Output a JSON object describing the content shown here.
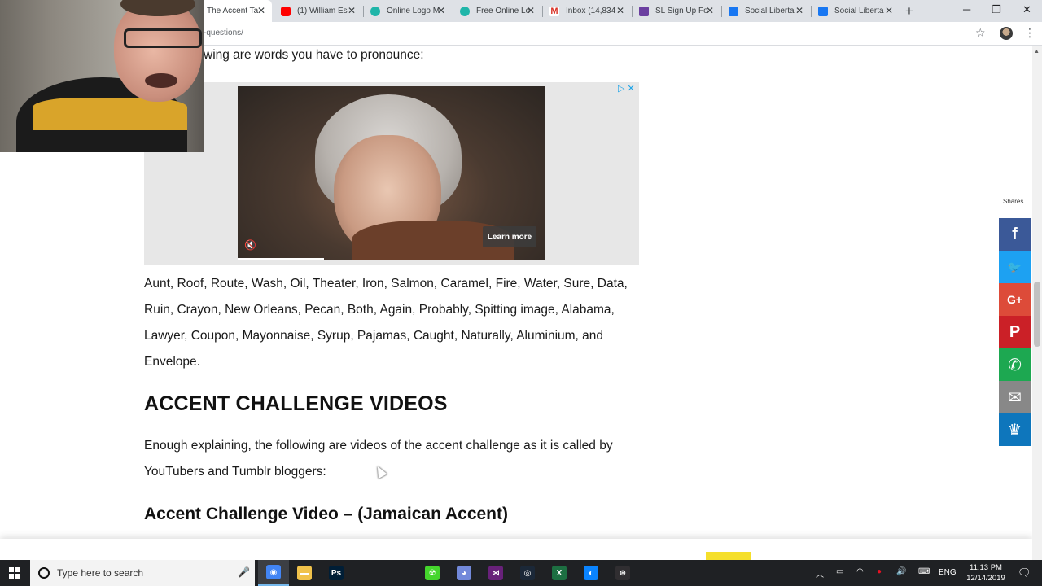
{
  "browser": {
    "tabs": [
      {
        "label": "The Accent Ta",
        "icon": "page-favicon-icon",
        "color": "#e8eaed",
        "active": true
      },
      {
        "label": "(1) William Es",
        "icon": "youtube-icon",
        "color": "#ff0000"
      },
      {
        "label": "Online Logo M",
        "icon": "logo-maker-icon",
        "color": "#1fb5a9"
      },
      {
        "label": "Free Online Lo",
        "icon": "logo-maker-icon",
        "color": "#1fb5a9"
      },
      {
        "label": "Inbox (14,834",
        "icon": "gmail-icon",
        "color": "#d93025"
      },
      {
        "label": "SL Sign Up Fo",
        "icon": "form-icon",
        "color": "#6b3fa0"
      },
      {
        "label": "Social Liberta",
        "icon": "facebook-icon",
        "color": "#1877f2"
      },
      {
        "label": "Social Liberta",
        "icon": "facebook-icon",
        "color": "#1877f2"
      }
    ],
    "new_tab": "+",
    "url": "-questions/",
    "window_controls": {
      "minimize": "─",
      "restore": "❐",
      "close": "✕"
    }
  },
  "article": {
    "intro_partial": "wing are words you have to pronounce:",
    "word_lines": [
      "Aunt, Roof, Route, Wash, Oil, Theater, Iron, Salmon, Caramel, Fire, Water, Sure, Data,",
      "Ruin, Crayon, New Orleans, Pecan, Both, Again, Probably, Spitting image, Alabama,",
      "Lawyer, Coupon, Mayonnaise, Syrup, Pajamas, Caught, Naturally, Aluminium, and",
      "Envelope."
    ],
    "section_heading": "ACCENT CHALLENGE VIDEOS",
    "explain_lines": [
      "Enough explaining, the following are videos of the accent challenge as it is called by",
      "YouTubers and Tumblr bloggers:"
    ],
    "sub_heading": "Accent Challenge Video – (Jamaican Accent)"
  },
  "ad": {
    "learn_more": "Learn more",
    "adchoices": "▷✕",
    "mute_icon": "🔇",
    "progress_fraction": 0.28
  },
  "share": {
    "label": "Shares",
    "buttons": [
      {
        "name": "facebook",
        "glyph": "f",
        "color": "#3b5998"
      },
      {
        "name": "twitter",
        "glyph": "🐦",
        "color": "#1da1f2"
      },
      {
        "name": "google-plus",
        "glyph": "G+",
        "color": "#dd4b39"
      },
      {
        "name": "pinterest",
        "glyph": "P",
        "color": "#cb2027"
      },
      {
        "name": "whatsapp",
        "glyph": "✆",
        "color": "#1da851"
      },
      {
        "name": "email",
        "glyph": "✉",
        "color": "#888888"
      },
      {
        "name": "sumo",
        "glyph": "♛",
        "color": "#0e76bc"
      }
    ]
  },
  "taskbar": {
    "search_placeholder": "Type here to search",
    "apps": [
      {
        "name": "chrome",
        "glyph": "◉",
        "color": "#4285f4",
        "active": true
      },
      {
        "name": "file-explorer",
        "glyph": "▬",
        "color": "#f0c24b"
      },
      {
        "name": "photoshop",
        "glyph": "Ps",
        "color": "#001e36"
      },
      {
        "name": "razer",
        "glyph": "☢",
        "color": "#44d62c"
      },
      {
        "name": "discord",
        "glyph": "◕",
        "color": "#7289da"
      },
      {
        "name": "visual-studio",
        "glyph": "⋈",
        "color": "#68217a"
      },
      {
        "name": "steam",
        "glyph": "◎",
        "color": "#1b2838"
      },
      {
        "name": "excel",
        "glyph": "X",
        "color": "#1d6f42"
      },
      {
        "name": "browser-app",
        "glyph": "◐",
        "color": "#0a84ff"
      },
      {
        "name": "obs",
        "glyph": "⊛",
        "color": "#302e31"
      }
    ],
    "tray_language": "ENG",
    "time": "11:13 PM",
    "date": "12/14/2019"
  }
}
